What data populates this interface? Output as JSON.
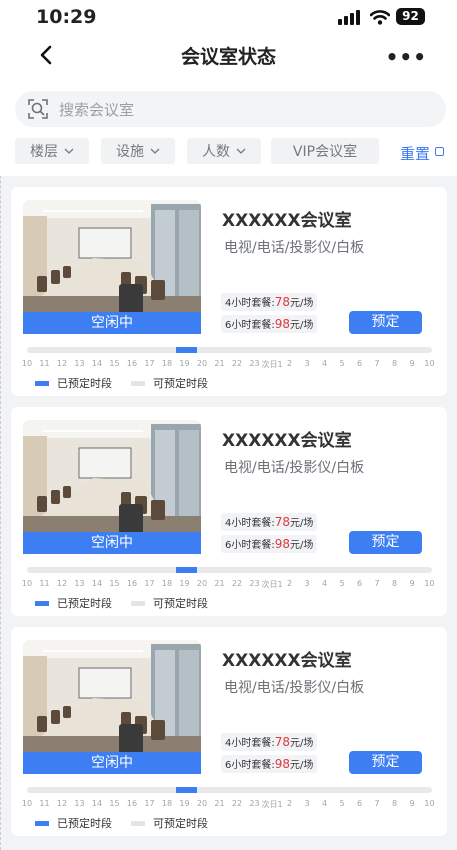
{
  "status_bar": {
    "time": "10:29",
    "battery": "92"
  },
  "header": {
    "title": "会议室状态"
  },
  "search": {
    "placeholder": "搜索会议室"
  },
  "filters": [
    "楼层",
    "设施",
    "人数",
    "VIP会议室"
  ],
  "reset_label": "重置",
  "rooms": [
    {
      "name": "XXXXXX会议室",
      "facilities": "电视/电话/投影仪/白板",
      "status": "空闲中",
      "packages": [
        {
          "label": "4小时套餐:",
          "price": "78",
          "unit": "元/场"
        },
        {
          "label": "6小时套餐:",
          "price": "98",
          "unit": "元/场"
        }
      ],
      "book_label": "预定",
      "booked_slot": {
        "start": "18",
        "end": "19"
      }
    },
    {
      "name": "XXXXXX会议室",
      "facilities": "电视/电话/投影仪/白板",
      "status": "空闲中",
      "packages": [
        {
          "label": "4小时套餐:",
          "price": "78",
          "unit": "元/场"
        },
        {
          "label": "6小时套餐:",
          "price": "98",
          "unit": "元/场"
        }
      ],
      "book_label": "预定",
      "booked_slot": {
        "start": "18",
        "end": "19"
      }
    },
    {
      "name": "XXXXXX会议室",
      "facilities": "电视/电话/投影仪/白板",
      "status": "空闲中",
      "packages": [
        {
          "label": "4小时套餐:",
          "price": "78",
          "unit": "元/场"
        },
        {
          "label": "6小时套餐:",
          "price": "98",
          "unit": "元/场"
        }
      ],
      "book_label": "预定",
      "booked_slot": {
        "start": "18",
        "end": "19"
      }
    }
  ],
  "timeline_ticks": [
    "10",
    "11",
    "12",
    "13",
    "14",
    "15",
    "16",
    "17",
    "18",
    "19",
    "20",
    "21",
    "22",
    "23",
    "次日1",
    "2",
    "3",
    "4",
    "5",
    "6",
    "7",
    "8",
    "9",
    "10"
  ],
  "legend": {
    "booked": "已预定时段",
    "available": "可预定时段"
  },
  "colors": {
    "accent": "#3d7ff3",
    "price": "#e03a3a",
    "available": "#e8e9eb"
  },
  "icons": {
    "back": "chevron-left-icon",
    "more": "more-icon",
    "search": "scan-icon",
    "filter": "chevron-down-icon",
    "reset": "square-icon"
  }
}
